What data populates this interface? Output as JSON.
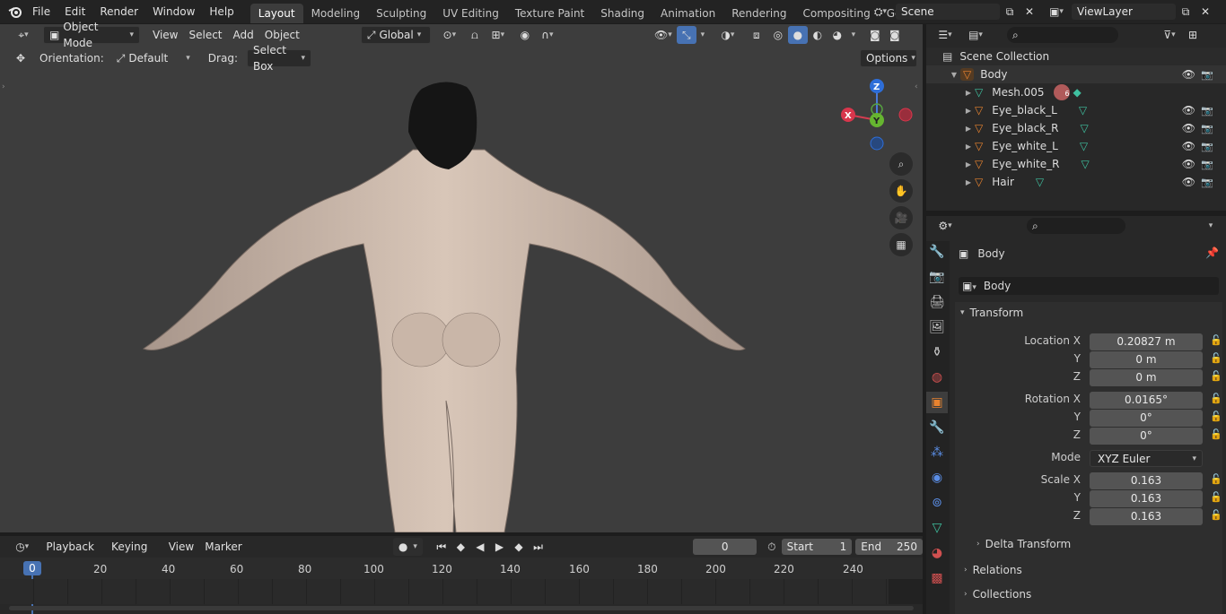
{
  "topbar": {
    "menus": [
      "File",
      "Edit",
      "Render",
      "Window",
      "Help"
    ],
    "workspaces": [
      "Layout",
      "Modeling",
      "Sculpting",
      "UV Editing",
      "Texture Paint",
      "Shading",
      "Animation",
      "Rendering",
      "Compositing",
      "Geometry Noc"
    ],
    "active_workspace": "Layout",
    "scene": "Scene",
    "view_layer": "ViewLayer"
  },
  "viewport_header": {
    "mode": "Object Mode",
    "menus": [
      "View",
      "Select",
      "Add",
      "Object"
    ],
    "transform_orientation": "Global",
    "orientation_label": "Orientation:",
    "orientation_value": "Default",
    "drag_label": "Drag:",
    "drag_value": "Select Box",
    "options_label": "Options"
  },
  "gizmo": {
    "z": "Z",
    "y": "Y",
    "x": "X"
  },
  "outliner": {
    "root": "Scene Collection",
    "body": "Body",
    "items": [
      {
        "name": "Mesh.005",
        "badge": "6"
      },
      {
        "name": "Eye_black_L"
      },
      {
        "name": "Eye_black_R"
      },
      {
        "name": "Eye_white_L"
      },
      {
        "name": "Eye_white_R"
      },
      {
        "name": "Hair"
      }
    ]
  },
  "properties": {
    "object_name": "Body",
    "object_field": "Body",
    "transform_panel": "Transform",
    "location": {
      "label_x": "Location X",
      "x": "0.20827 m",
      "y": "0 m",
      "z": "0 m"
    },
    "rotation": {
      "label_x": "Rotation X",
      "x": "0.0165°",
      "y": "0°",
      "z": "0°"
    },
    "mode_label": "Mode",
    "mode_value": "XYZ Euler",
    "scale": {
      "label_x": "Scale X",
      "x": "0.163",
      "y": "0.163",
      "z": "0.163"
    },
    "axis_y": "Y",
    "axis_z": "Z",
    "delta_panel": "Delta Transform",
    "relations_panel": "Relations",
    "collections_panel": "Collections"
  },
  "timeline": {
    "menus": [
      "Playback",
      "Keying",
      "View",
      "Marker"
    ],
    "current_frame": "0",
    "start_label": "Start",
    "start_value": "1",
    "end_label": "End",
    "end_value": "250",
    "ticks": [
      "0",
      "20",
      "40",
      "60",
      "80",
      "100",
      "120",
      "140",
      "160",
      "180",
      "200",
      "220",
      "240"
    ]
  },
  "colors": {
    "accent": "#4772b3",
    "active_orange": "#e8832f",
    "mesh_green": "#3fc1a0"
  }
}
